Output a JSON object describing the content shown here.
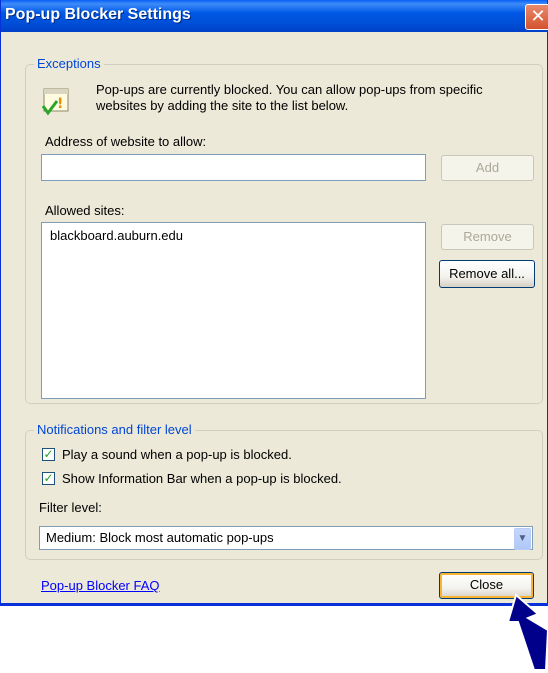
{
  "window": {
    "title": "Pop-up Blocker Settings"
  },
  "exceptions": {
    "legend": "Exceptions",
    "info_line1": "Pop-ups are currently blocked.  You can allow pop-ups from specific",
    "info_line2": "websites by adding the site to the list below.",
    "address_label": "Address of website to allow:",
    "address_value": "",
    "add_button": "Add",
    "allowed_label": "Allowed sites:",
    "allowed_sites": [
      "blackboard.auburn.edu"
    ],
    "remove_button": "Remove",
    "remove_all_button": "Remove all..."
  },
  "notifications": {
    "legend": "Notifications and filter level",
    "play_sound_label": "Play a sound when a pop-up is blocked.",
    "play_sound_checked": true,
    "show_infobar_label": "Show Information Bar when a pop-up is blocked.",
    "show_infobar_checked": true,
    "filter_label": "Filter level:",
    "filter_value": "Medium: Block most automatic pop-ups"
  },
  "footer": {
    "faq_link": "Pop-up Blocker FAQ",
    "close_button": "Close"
  },
  "colors": {
    "titlebar": "#0058e6",
    "legend_text": "#0046d5",
    "dialog_bg": "#ece9d8",
    "arrow": "#00008b"
  },
  "icons": [
    "close-icon",
    "info-warning-icon",
    "checkbox-check-icon",
    "dropdown-arrow-icon",
    "pointer-arrow-annotation"
  ]
}
